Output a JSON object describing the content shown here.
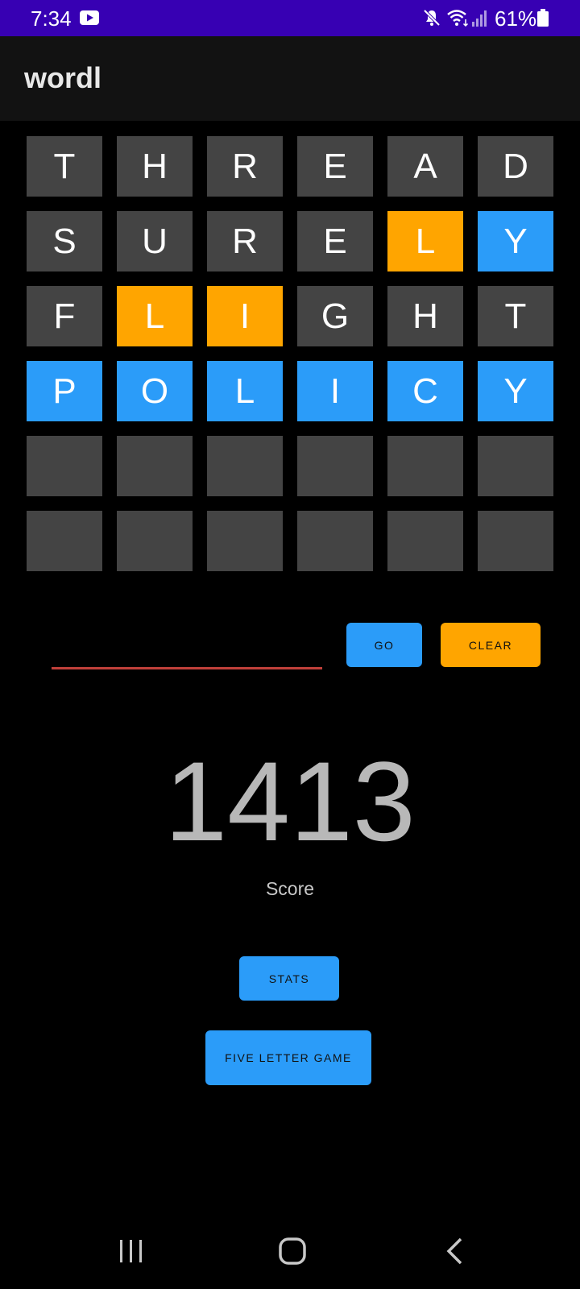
{
  "status_bar": {
    "time": "7:34",
    "battery": "61%",
    "icons": [
      "youtube-icon",
      "mute-icon",
      "wifi-icon",
      "signal-icon",
      "battery-icon"
    ],
    "background": "#3700b3"
  },
  "app_bar": {
    "title": "wordl"
  },
  "grid": {
    "colors": {
      "absent": "#444444",
      "present": "#ffa500",
      "correct": "#2b9cf9"
    },
    "rows": [
      [
        {
          "letter": "T",
          "state": "absent"
        },
        {
          "letter": "H",
          "state": "absent"
        },
        {
          "letter": "R",
          "state": "absent"
        },
        {
          "letter": "E",
          "state": "absent"
        },
        {
          "letter": "A",
          "state": "absent"
        },
        {
          "letter": "D",
          "state": "absent"
        }
      ],
      [
        {
          "letter": "S",
          "state": "absent"
        },
        {
          "letter": "U",
          "state": "absent"
        },
        {
          "letter": "R",
          "state": "absent"
        },
        {
          "letter": "E",
          "state": "absent"
        },
        {
          "letter": "L",
          "state": "present"
        },
        {
          "letter": "Y",
          "state": "correct"
        }
      ],
      [
        {
          "letter": "F",
          "state": "absent"
        },
        {
          "letter": "L",
          "state": "present"
        },
        {
          "letter": "I",
          "state": "present"
        },
        {
          "letter": "G",
          "state": "absent"
        },
        {
          "letter": "H",
          "state": "absent"
        },
        {
          "letter": "T",
          "state": "absent"
        }
      ],
      [
        {
          "letter": "P",
          "state": "correct"
        },
        {
          "letter": "O",
          "state": "correct"
        },
        {
          "letter": "L",
          "state": "correct"
        },
        {
          "letter": "I",
          "state": "correct"
        },
        {
          "letter": "C",
          "state": "correct"
        },
        {
          "letter": "Y",
          "state": "correct"
        }
      ],
      [
        {
          "letter": "",
          "state": "absent"
        },
        {
          "letter": "",
          "state": "absent"
        },
        {
          "letter": "",
          "state": "absent"
        },
        {
          "letter": "",
          "state": "absent"
        },
        {
          "letter": "",
          "state": "absent"
        },
        {
          "letter": "",
          "state": "absent"
        }
      ],
      [
        {
          "letter": "",
          "state": "absent"
        },
        {
          "letter": "",
          "state": "absent"
        },
        {
          "letter": "",
          "state": "absent"
        },
        {
          "letter": "",
          "state": "absent"
        },
        {
          "letter": "",
          "state": "absent"
        },
        {
          "letter": "",
          "state": "absent"
        }
      ]
    ]
  },
  "input": {
    "value": "",
    "placeholder": ""
  },
  "buttons": {
    "go": "GO",
    "clear": "CLEAR",
    "stats": "STATS",
    "five_letter": "FIVE LETTER GAME"
  },
  "score": {
    "value": "1413",
    "label": "Score"
  },
  "nav_bar": {
    "icons": [
      "recent-apps-icon",
      "home-icon",
      "back-icon"
    ]
  }
}
